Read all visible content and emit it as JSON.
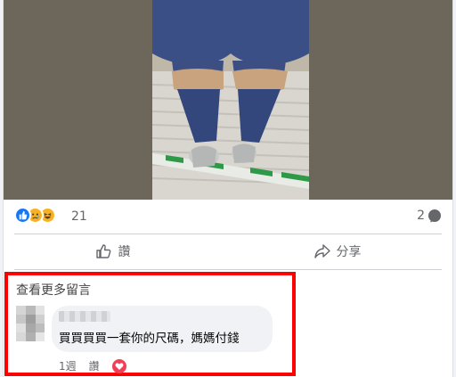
{
  "reactions": {
    "icons": [
      "like-icon",
      "sad-icon",
      "haha-icon"
    ],
    "count": "21",
    "comments_count": "2"
  },
  "actions": {
    "like_label": "讚",
    "share_label": "分享"
  },
  "comments": {
    "view_more": "查看更多留言",
    "items": [
      {
        "text": "買買買買一套你的尺碼，媽媽付錢",
        "time": "1週",
        "like_label": "讚",
        "reaction": "heart-icon"
      }
    ]
  },
  "colors": {
    "highlight": "#ff0000",
    "like": "#1877f2",
    "love": "#f33e58",
    "text_secondary": "#65676b"
  }
}
